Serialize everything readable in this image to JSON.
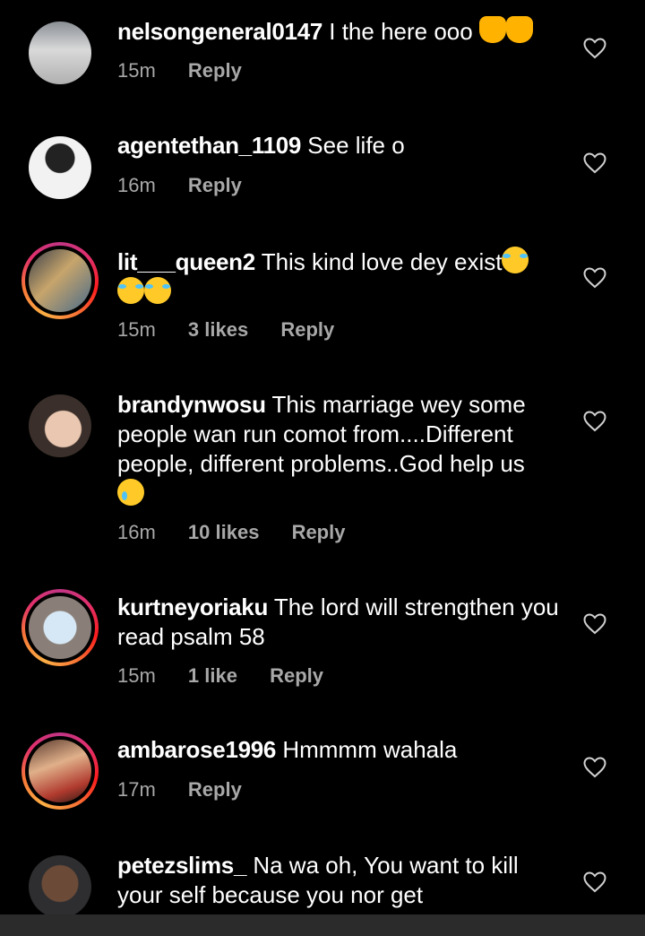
{
  "comments": [
    {
      "username": "nelsongeneral0147",
      "text": "I the here ooo",
      "emoji": [
        "raised-hands",
        "raised-hands"
      ],
      "time": "15m",
      "likes": "",
      "reply": "Reply",
      "story_ring": false
    },
    {
      "username": "agentethan_1109",
      "text": "See  life o",
      "emoji": [],
      "time": "16m",
      "likes": "",
      "reply": "Reply",
      "story_ring": false
    },
    {
      "username": "lit___queen2",
      "text": "This kind love dey exist",
      "emoji": [
        "tears-of-joy",
        "tears-of-joy",
        "tears-of-joy"
      ],
      "time": "15m",
      "likes": "3 likes",
      "reply": "Reply",
      "story_ring": true
    },
    {
      "username": "brandynwosu",
      "text": "This marriage wey some people wan run comot from....Different people, different problems..God help us",
      "emoji": [
        "crying-face"
      ],
      "time": "16m",
      "likes": "10 likes",
      "reply": "Reply",
      "story_ring": false
    },
    {
      "username": "kurtneyoriaku",
      "text": "The lord will strengthen you read psalm 58",
      "emoji": [],
      "time": "15m",
      "likes": "1 like",
      "reply": "Reply",
      "story_ring": true
    },
    {
      "username": "ambarose1996",
      "text": "Hmmmm wahala",
      "emoji": [],
      "time": "17m",
      "likes": "",
      "reply": "Reply",
      "story_ring": true
    },
    {
      "username": "petezslims_",
      "text": "Na wa oh, You want to kill your self because you nor get",
      "emoji": [],
      "time": "",
      "likes": "",
      "reply": "",
      "story_ring": false
    }
  ],
  "colors": {
    "background": "#000000",
    "meta_text": "#a8a8a8",
    "heart_stroke": "#d0d0d0"
  }
}
